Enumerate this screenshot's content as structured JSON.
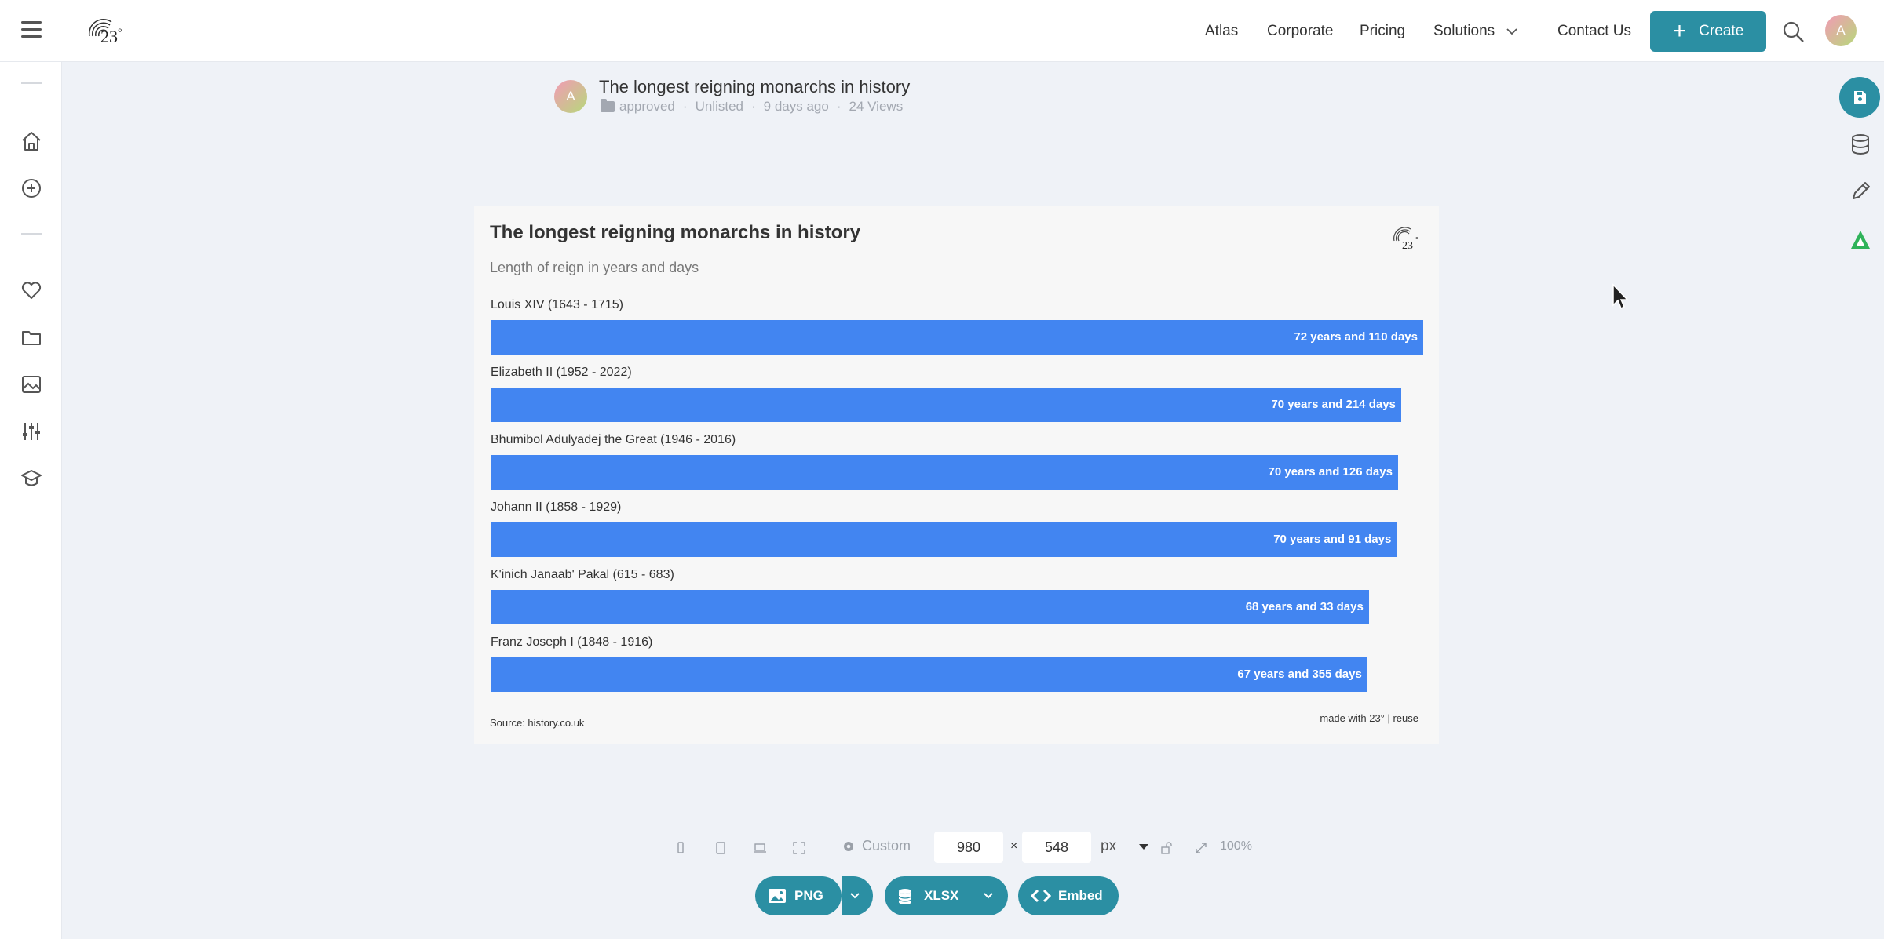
{
  "topbar": {
    "logo_text": "23",
    "logo_degree": "°",
    "nav": [
      "Atlas",
      "Corporate",
      "Pricing",
      "Solutions",
      "Contact Us"
    ],
    "create_label": "Create",
    "user_initial": "A"
  },
  "document": {
    "author_initial": "A",
    "title": "The longest reigning monarchs in history",
    "folder": "approved",
    "visibility": "Unlisted",
    "age": "9 days ago",
    "views": "24 Views"
  },
  "chart_data": {
    "type": "bar",
    "orientation": "horizontal",
    "title": "The longest reigning monarchs in history",
    "subtitle": "Length of reign in years and days",
    "categories": [
      "Louis XIV (1643 - 1715)",
      "Elizabeth II (1952 - 2022)",
      "Bhumibol Adulyadej the Great (1946 - 2016)",
      "Johann II (1858 - 1929)",
      "K'inich Janaab' Pakal (615 - 683)",
      "Franz Joseph I (1848 - 1916)"
    ],
    "values": [
      72.3,
      70.59,
      70.35,
      70.25,
      68.09,
      67.97
    ],
    "value_labels": [
      "72 years and 110 days",
      "70 years and 214 days",
      "70 years and 126 days",
      "70 years and 91 days",
      "68 years and 33 days",
      "67 years and 355 days"
    ],
    "bar_color": "#4285f1",
    "source": "Source: history.co.uk",
    "credit": "made with 23° | reuse"
  },
  "controls": {
    "preset": "Custom",
    "width": "980",
    "height": "548",
    "times": "×",
    "unit": "px",
    "zoom": "100%"
  },
  "export": {
    "png": "PNG",
    "xlsx": "XLSX",
    "embed": "Embed"
  },
  "colors": {
    "accent": "#2b8fa3",
    "bar": "#4285f1"
  }
}
